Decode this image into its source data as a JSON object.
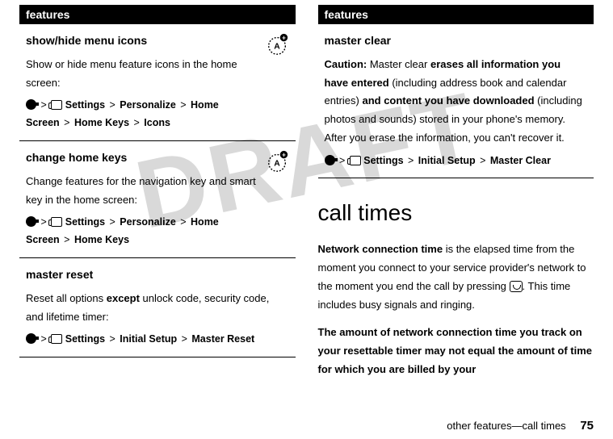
{
  "watermark": "DRAFT",
  "left": {
    "header": "features",
    "rows": [
      {
        "title": "show/hide menu icons",
        "badge": true,
        "body": "Show or hide menu feature icons in the home screen:",
        "pathParts": [
          "Settings",
          "Personalize",
          "Home Screen",
          "Home Keys",
          "Icons"
        ]
      },
      {
        "title": "change home keys",
        "badge": true,
        "body": "Change features for the navigation key and smart key in the home screen:",
        "pathParts": [
          "Settings",
          "Personalize",
          "Home Screen",
          "Home Keys"
        ]
      },
      {
        "title": "master reset",
        "badge": false,
        "body_pre": "Reset all options ",
        "body_b": "except",
        "body_post": " unlock code, security code, and lifetime timer:",
        "pathParts": [
          "Settings",
          "Initial Setup",
          "Master Reset"
        ]
      }
    ]
  },
  "right": {
    "header": "features",
    "rows": [
      {
        "title": "master clear",
        "caution_label": "Caution:",
        "caution_1a": " Master clear ",
        "caution_1b": "erases all information you have entered",
        "caution_2a": " (including address book and calendar entries) ",
        "caution_2b": "and content you have downloaded",
        "caution_3": " (including photos and sounds) stored in your phone's memory. After you erase the information, you can't recover it.",
        "pathParts": [
          "Settings",
          "Initial Setup",
          "Master Clear"
        ]
      }
    ],
    "section_title": "call times",
    "para1_b": "Network connection time",
    "para1_rest_a": " is the elapsed time from the moment you connect to your service provider's network to the moment you end the call by pressing ",
    "para1_rest_b": ". This time includes busy signals and ringing.",
    "para2": "The amount of network connection time you track on your resettable timer may not equal the amount of time for which you are billed by your"
  },
  "footer": {
    "text": "other features—call times",
    "page": "75"
  }
}
